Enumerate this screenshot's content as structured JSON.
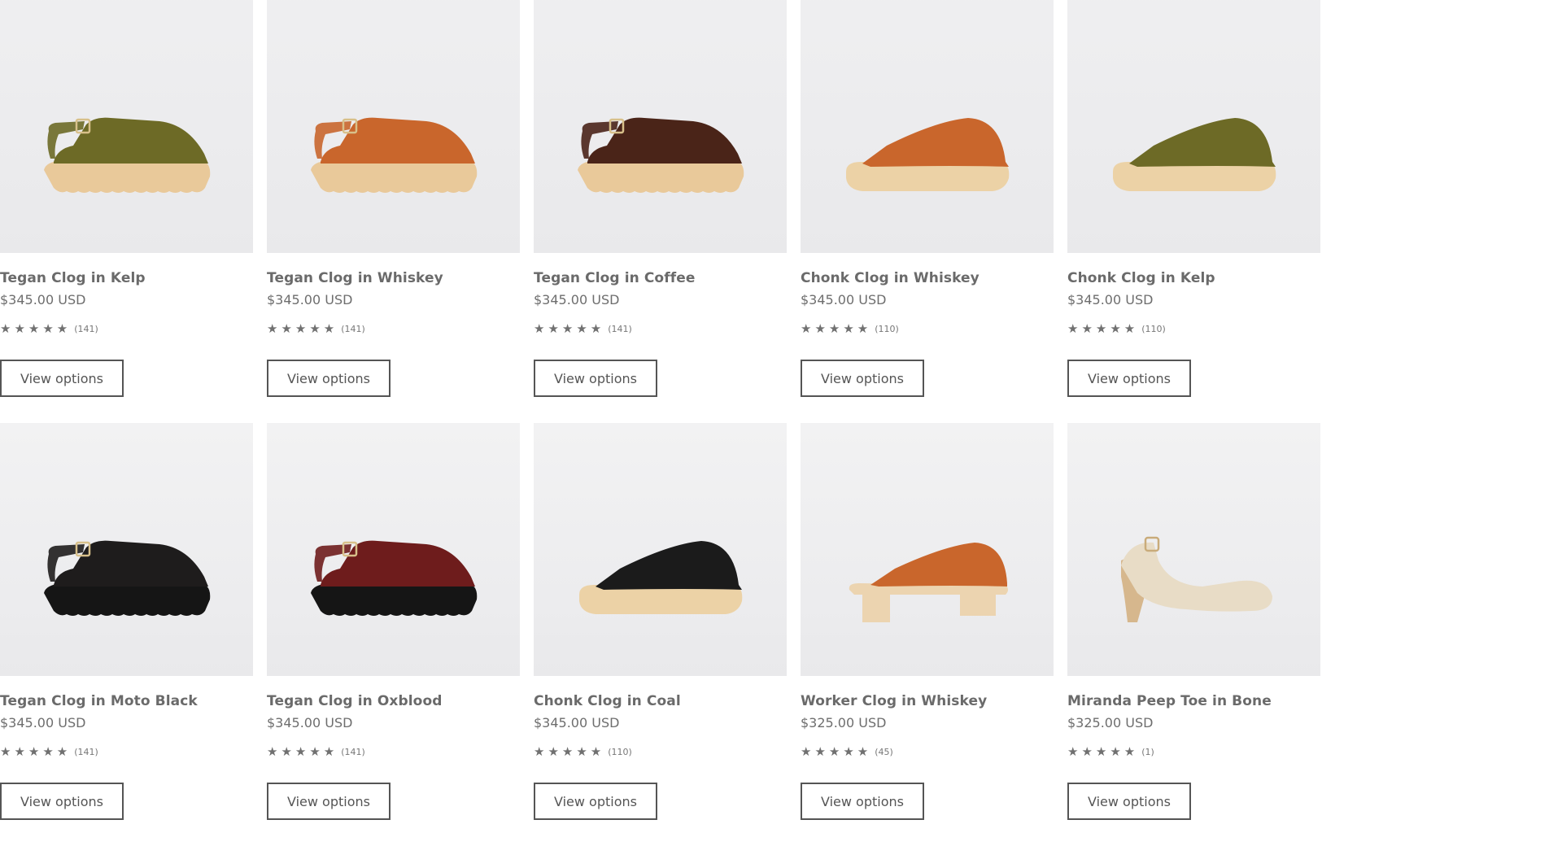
{
  "button_label": "View options",
  "products": [
    {
      "title": "Tegan Clog in Kelp",
      "price": "$345.00 USD",
      "stars": "★★★★★",
      "count": "(141)",
      "style": "tegan",
      "upper": "#6d6a26",
      "sole": "#e9c99a"
    },
    {
      "title": "Tegan Clog in Whiskey",
      "price": "$345.00 USD",
      "stars": "★★★★★",
      "count": "(141)",
      "style": "tegan",
      "upper": "#c9662c",
      "sole": "#e9c99a"
    },
    {
      "title": "Tegan Clog in Coffee",
      "price": "$345.00 USD",
      "stars": "★★★★★",
      "count": "(141)",
      "style": "tegan",
      "upper": "#4a2418",
      "sole": "#e9c99a"
    },
    {
      "title": "Chonk Clog in Whiskey",
      "price": "$345.00 USD",
      "stars": "★★★★★",
      "count": "(110)",
      "style": "chonk",
      "upper": "#c9662c",
      "sole": "#ecd2a6"
    },
    {
      "title": "Chonk Clog in Kelp",
      "price": "$345.00 USD",
      "stars": "★★★★★",
      "count": "(110)",
      "style": "chonk",
      "upper": "#6d6a26",
      "sole": "#ecd2a6"
    },
    {
      "title": "Tegan Clog in Moto Black",
      "price": "$345.00 USD",
      "stars": "★★★★★",
      "count": "(141)",
      "style": "tegan",
      "upper": "#1e1c1c",
      "sole": "#151515"
    },
    {
      "title": "Tegan Clog in Oxblood",
      "price": "$345.00 USD",
      "stars": "★★★★★",
      "count": "(141)",
      "style": "tegan",
      "upper": "#6e1c1c",
      "sole": "#151515"
    },
    {
      "title": "Chonk Clog in Coal",
      "price": "$345.00 USD",
      "stars": "★★★★★",
      "count": "(110)",
      "style": "chonk",
      "upper": "#1b1b1b",
      "sole": "#ecd2a6"
    },
    {
      "title": "Worker Clog in Whiskey",
      "price": "$325.00 USD",
      "stars": "★★★★★",
      "count": "(45)",
      "style": "worker",
      "upper": "#c9662c",
      "sole": "#ecd4b0"
    },
    {
      "title": "Miranda Peep Toe in Bone",
      "price": "$325.00 USD",
      "stars": "★★★★★",
      "count": "(1)",
      "style": "miranda",
      "upper": "#e8dcc6",
      "sole": "#d6b78d"
    }
  ]
}
